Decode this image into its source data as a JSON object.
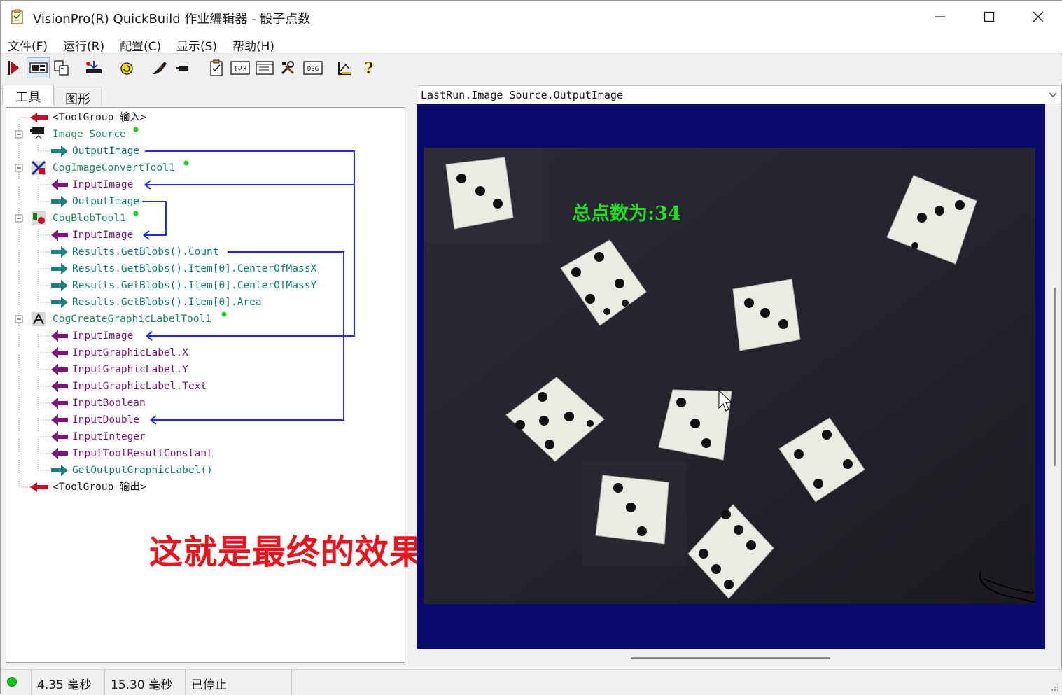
{
  "window": {
    "title": "VisionPro(R) QuickBuild 作业编辑器 - 骰子点数"
  },
  "menu": [
    "文件(F)",
    "运行(R)",
    "配置(C)",
    "显示(S)",
    "帮助(H)"
  ],
  "toolbar": {
    "buttons": [
      "run-once-icon",
      "display-toggle-icon",
      "copy-icon",
      "import-icon",
      "reset-icon",
      "edit-icon",
      "record-icon",
      "job-properties-icon",
      "numbers-icon",
      "form-icon",
      "tools-icon",
      "dbg-icon",
      "measure-icon",
      "help-icon"
    ],
    "dbg_label": "DBG",
    "num_label": "123"
  },
  "tabs": [
    "工具",
    "图形"
  ],
  "tree": {
    "nodes": [
      {
        "text": "<ToolGroup 输入>",
        "kind": "group"
      },
      {
        "text": "Image Source",
        "kind": "tool"
      },
      {
        "text": "OutputImage",
        "kind": "output"
      },
      {
        "text": "CogImageConvertTool1",
        "kind": "tool"
      },
      {
        "text": "InputImage",
        "kind": "input"
      },
      {
        "text": "OutputImage",
        "kind": "output"
      },
      {
        "text": "CogBlobTool1",
        "kind": "tool"
      },
      {
        "text": "InputImage",
        "kind": "input"
      },
      {
        "text": "Results.GetBlobs().Count",
        "kind": "output"
      },
      {
        "text": "Results.GetBlobs().Item[0].CenterOfMassX",
        "kind": "output"
      },
      {
        "text": "Results.GetBlobs().Item[0].CenterOfMassY",
        "kind": "output"
      },
      {
        "text": "Results.GetBlobs().Item[0].Area",
        "kind": "output"
      },
      {
        "text": "CogCreateGraphicLabelTool1",
        "kind": "tool"
      },
      {
        "text": "InputImage",
        "kind": "input"
      },
      {
        "text": "InputGraphicLabel.X",
        "kind": "input"
      },
      {
        "text": "InputGraphicLabel.Y",
        "kind": "input"
      },
      {
        "text": "InputGraphicLabel.Text",
        "kind": "input"
      },
      {
        "text": "InputBoolean",
        "kind": "input"
      },
      {
        "text": "InputDouble",
        "kind": "input"
      },
      {
        "text": "InputInteger",
        "kind": "input"
      },
      {
        "text": "InputToolResultConstant",
        "kind": "input"
      },
      {
        "text": "GetOutputGraphicLabel()",
        "kind": "output"
      },
      {
        "text": "<ToolGroup 输出>",
        "kind": "group"
      }
    ]
  },
  "overlay_caption": "这就是最终的效果显示",
  "display": {
    "selector_value": "LastRun.Image Source.OutputImage",
    "result_label": "总点数为:34"
  },
  "status": {
    "time1": "4.35 毫秒",
    "time2": "15.30 毫秒",
    "state": "已停止"
  },
  "colors": {
    "display_bg": "#0a0a6e",
    "result_label": "#22dd22",
    "link_line": "#1f2fe0",
    "caption": "#e8141e",
    "status_led": "#12c412"
  }
}
